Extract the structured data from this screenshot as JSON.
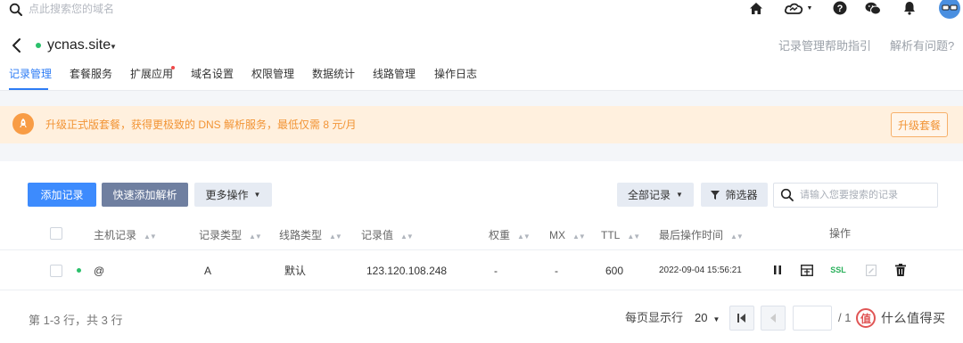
{
  "topbar": {
    "search_placeholder": "点此搜索您的域名",
    "icons": [
      "search-icon",
      "home-icon",
      "cloud-icon",
      "help-icon",
      "wechat-icon",
      "bell-icon",
      "avatar"
    ]
  },
  "header": {
    "domain": "ycnas.site",
    "help_guide": "记录管理帮助指引",
    "resolve_issue": "解析有问题?"
  },
  "tabs": [
    {
      "label": "记录管理",
      "active": true
    },
    {
      "label": "套餐服务"
    },
    {
      "label": "扩展应用",
      "badge": true
    },
    {
      "label": "域名设置"
    },
    {
      "label": "权限管理"
    },
    {
      "label": "数据统计"
    },
    {
      "label": "线路管理"
    },
    {
      "label": "操作日志"
    }
  ],
  "banner": {
    "text": "升级正式版套餐，获得更极致的 DNS 解析服务，最低仅需 8 元/月",
    "button": "升级套餐"
  },
  "toolbar": {
    "add_record": "添加记录",
    "quick_add": "快速添加解析",
    "more_actions": "更多操作",
    "all_records": "全部记录",
    "filter": "筛选器",
    "search_placeholder": "请输入您要搜索的记录"
  },
  "table": {
    "headers": {
      "host": "主机记录",
      "type": "记录类型",
      "line": "线路类型",
      "value": "记录值",
      "weight": "权重",
      "mx": "MX",
      "ttl": "TTL",
      "last_op": "最后操作时间",
      "actions": "操作"
    },
    "rows": [
      {
        "host": "@",
        "type": "A",
        "line": "默认",
        "value": "123.120.108.248",
        "weight": "-",
        "mx": "-",
        "ttl": "600",
        "last_op": "2022-09-04 15:56:21",
        "ssl": "SSL",
        "enabled": true
      }
    ]
  },
  "footer": {
    "summary": "第 1-3 行，共 3 行",
    "per_page_label": "每页显示行",
    "per_page_value": "20",
    "total_pages": "/ 1",
    "watermark": "什么值得买"
  },
  "colors": {
    "accent": "#3d8bfd",
    "active_tab": "#2d7cf5",
    "banner_bg": "#fff0de",
    "banner_text": "#f29435",
    "status_green": "#2bc06b",
    "ssl_green": "#29b05a"
  }
}
